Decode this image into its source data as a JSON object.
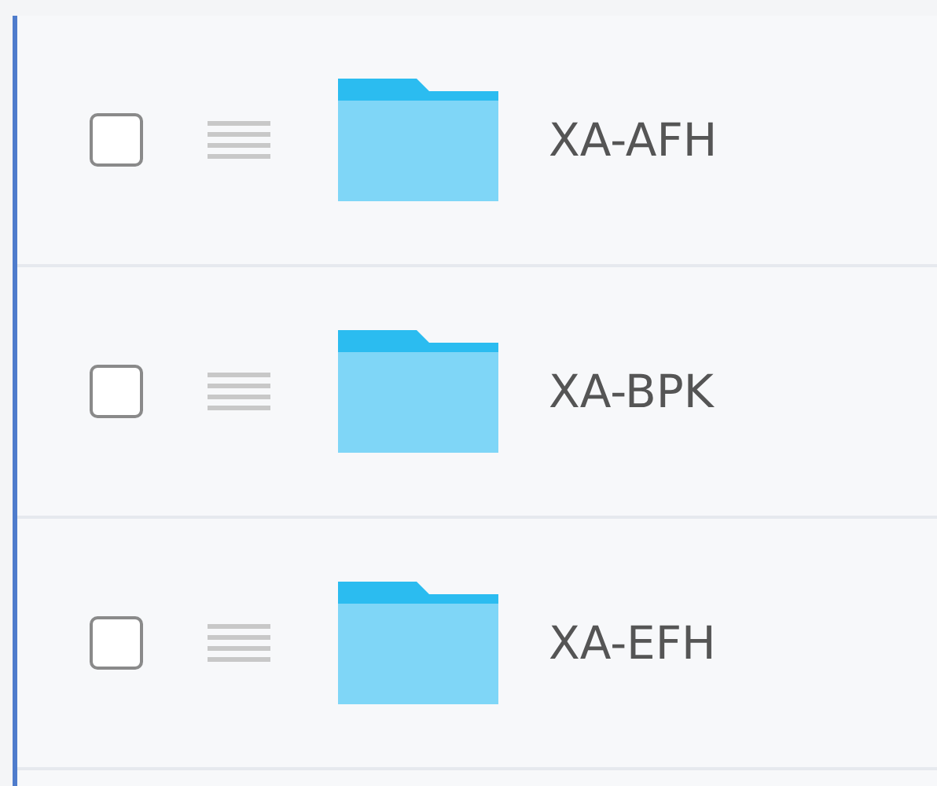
{
  "rows": [
    {
      "name": "XA-AFH",
      "checked": false
    },
    {
      "name": "XA-BPK",
      "checked": false
    },
    {
      "name": "XA-EFH",
      "checked": false
    }
  ]
}
